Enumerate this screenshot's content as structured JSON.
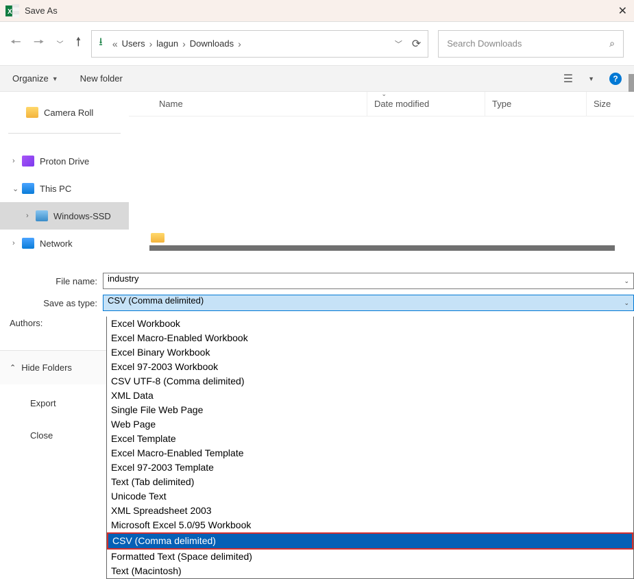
{
  "title": "Save As",
  "path": {
    "segments": [
      "Users",
      "lagun",
      "Downloads"
    ]
  },
  "search_placeholder": "Search Downloads",
  "toolbar": {
    "organize": "Organize",
    "newfolder": "New folder"
  },
  "tree": {
    "camera_roll": "Camera Roll",
    "proton": "Proton Drive",
    "thispc": "This PC",
    "windows_ssd": "Windows-SSD",
    "network": "Network"
  },
  "columns": {
    "name": "Name",
    "date": "Date modified",
    "type": "Type",
    "size": "Size"
  },
  "form": {
    "filename_label": "File name:",
    "filename_value": "industry",
    "type_label": "Save as type:",
    "type_value": "CSV (Comma delimited)",
    "authors_label": "Authors:"
  },
  "type_options": [
    "Excel Workbook",
    "Excel Macro-Enabled Workbook",
    "Excel Binary Workbook",
    "Excel 97-2003 Workbook",
    "CSV UTF-8 (Comma delimited)",
    "XML Data",
    "Single File Web Page",
    "Web Page",
    "Excel Template",
    "Excel Macro-Enabled Template",
    "Excel 97-2003 Template",
    "Text (Tab delimited)",
    "Unicode Text",
    "XML Spreadsheet 2003",
    "Microsoft Excel 5.0/95 Workbook",
    "CSV (Comma delimited)",
    "Formatted Text (Space delimited)",
    "Text (Macintosh)"
  ],
  "selected_type_index": 15,
  "sidebottom": {
    "hidefolders": "Hide Folders",
    "export": "Export",
    "close": "Close"
  }
}
